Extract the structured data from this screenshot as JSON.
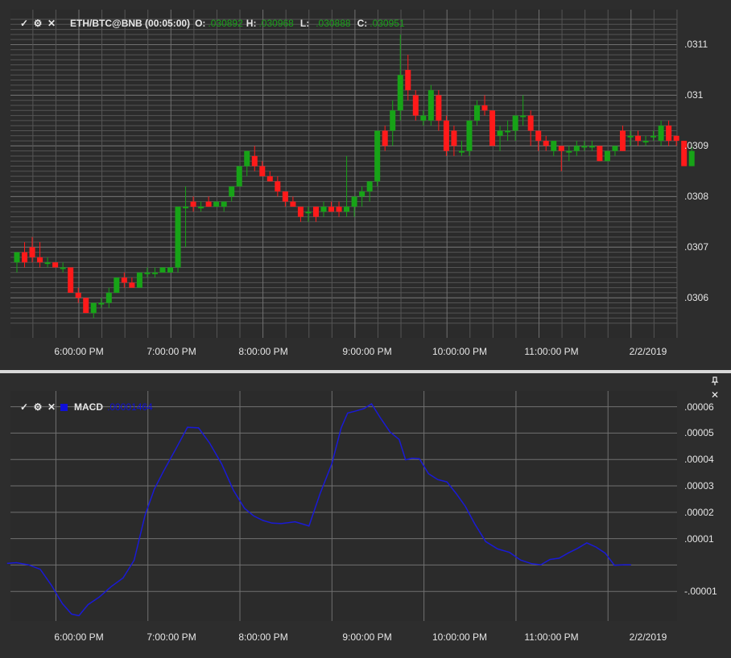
{
  "main_pane": {
    "legend": {
      "symbol": "ETH/BTC@BNB (00:05:00)",
      "open_label": "O:",
      "open_value": ".030892",
      "high_label": "H:",
      "high_value": ".030968",
      "low_label": "L:",
      "low_value": ".030888",
      "close_label": "C:",
      "close_value": ".030951",
      "value_color": "#1aa01a"
    },
    "y_ticks": [
      ".0311",
      ".031",
      ".0309",
      ".0308",
      ".0307",
      ".0306"
    ]
  },
  "macd_pane": {
    "legend": {
      "name": "MACD",
      "value": ".00001464",
      "color": "#1010d8"
    },
    "y_ticks": [
      ".00006",
      ".00005",
      ".00004",
      ".00003",
      ".00002",
      ".00001",
      "-.00001"
    ],
    "pin_icon": "pin-icon",
    "close_icon": "close-icon"
  },
  "time_axis": [
    "6:00:00 PM",
    "7:00:00 PM",
    "8:00:00 PM",
    "9:00:00 PM",
    "10:00:00 PM",
    "11:00:00 PM",
    "2/2/2019"
  ],
  "colors": {
    "up": "#17a317",
    "down": "#ff1a1a",
    "line": "#1a1ad6",
    "grid": "#555555",
    "grid_major": "#707070"
  },
  "chart_data": [
    {
      "type": "candlestick",
      "bar_interval": "00:05:00",
      "ylim": [
        0.03054,
        0.03115
      ],
      "y_ticks": [
        0.0306,
        0.0307,
        0.0308,
        0.0309,
        0.031,
        0.0311
      ],
      "x_start": "5:13 PM",
      "candles": [
        [
          0.03067,
          0.03069,
          0.03065,
          0.03069
        ],
        [
          0.03069,
          0.03071,
          0.03066,
          0.03067
        ],
        [
          0.0307,
          0.03072,
          0.03067,
          0.03068
        ],
        [
          0.03068,
          0.03071,
          0.03066,
          0.03067
        ],
        [
          0.03067,
          0.03068,
          0.03066,
          0.03067
        ],
        [
          0.03067,
          0.03067,
          0.03066,
          0.03066
        ],
        [
          0.03066,
          0.03067,
          0.03065,
          0.03066
        ],
        [
          0.03066,
          0.03066,
          0.03061,
          0.03061
        ],
        [
          0.03061,
          0.03062,
          0.03059,
          0.0306
        ],
        [
          0.0306,
          0.0306,
          0.03057,
          0.03057
        ],
        [
          0.03057,
          0.03059,
          0.03056,
          0.03059
        ],
        [
          0.03059,
          0.0306,
          0.03058,
          0.03059
        ],
        [
          0.03059,
          0.03062,
          0.03058,
          0.03061
        ],
        [
          0.03061,
          0.03064,
          0.03061,
          0.03064
        ],
        [
          0.03064,
          0.03065,
          0.03062,
          0.03063
        ],
        [
          0.03063,
          0.03064,
          0.03062,
          0.03062
        ],
        [
          0.03062,
          0.03065,
          0.03062,
          0.03065
        ],
        [
          0.03065,
          0.03066,
          0.03064,
          0.03065
        ],
        [
          0.03065,
          0.03066,
          0.03064,
          0.03065
        ],
        [
          0.03065,
          0.03066,
          0.03065,
          0.03066
        ],
        [
          0.03065,
          0.03066,
          0.03065,
          0.03066
        ],
        [
          0.03066,
          0.03078,
          0.03065,
          0.03078
        ],
        [
          0.03078,
          0.03082,
          0.0307,
          0.03078
        ],
        [
          0.03079,
          0.0308,
          0.03077,
          0.03078
        ],
        [
          0.03078,
          0.03079,
          0.03077,
          0.03078
        ],
        [
          0.03079,
          0.0308,
          0.03078,
          0.03078
        ],
        [
          0.03078,
          0.03079,
          0.03078,
          0.03079
        ],
        [
          0.03078,
          0.03079,
          0.03077,
          0.03079
        ],
        [
          0.0308,
          0.03082,
          0.03079,
          0.03082
        ],
        [
          0.03082,
          0.03086,
          0.03082,
          0.03086
        ],
        [
          0.03086,
          0.03089,
          0.03084,
          0.03089
        ],
        [
          0.03088,
          0.0309,
          0.03085,
          0.03086
        ],
        [
          0.03086,
          0.03087,
          0.03084,
          0.03084
        ],
        [
          0.03084,
          0.03085,
          0.03083,
          0.03083
        ],
        [
          0.03083,
          0.03084,
          0.0308,
          0.03081
        ],
        [
          0.03081,
          0.03081,
          0.03078,
          0.03079
        ],
        [
          0.03079,
          0.0308,
          0.03078,
          0.03078
        ],
        [
          0.03078,
          0.03078,
          0.03075,
          0.03076
        ],
        [
          0.03077,
          0.03078,
          0.03075,
          0.03077
        ],
        [
          0.03078,
          0.03078,
          0.03075,
          0.03076
        ],
        [
          0.03077,
          0.03079,
          0.03076,
          0.03078
        ],
        [
          0.03078,
          0.03079,
          0.03077,
          0.03077
        ],
        [
          0.03078,
          0.03079,
          0.03076,
          0.03077
        ],
        [
          0.03077,
          0.03088,
          0.03076,
          0.03078
        ],
        [
          0.03078,
          0.0308,
          0.03076,
          0.0308
        ],
        [
          0.0308,
          0.03082,
          0.03078,
          0.03081
        ],
        [
          0.03081,
          0.03083,
          0.03079,
          0.03083
        ],
        [
          0.03083,
          0.03093,
          0.03082,
          0.03093
        ],
        [
          0.03093,
          0.03094,
          0.03089,
          0.0309
        ],
        [
          0.03093,
          0.03099,
          0.0309,
          0.03097
        ],
        [
          0.03097,
          0.03112,
          0.03095,
          0.03104
        ],
        [
          0.03105,
          0.03108,
          0.03099,
          0.03101
        ],
        [
          0.031,
          0.03101,
          0.03095,
          0.03096
        ],
        [
          0.03095,
          0.03097,
          0.03094,
          0.03096
        ],
        [
          0.03095,
          0.03102,
          0.03094,
          0.03101
        ],
        [
          0.031,
          0.03101,
          0.03093,
          0.03095
        ],
        [
          0.03095,
          0.03096,
          0.03088,
          0.03089
        ],
        [
          0.03093,
          0.03094,
          0.03088,
          0.0309
        ],
        [
          0.03089,
          0.03091,
          0.03088,
          0.03089
        ],
        [
          0.03089,
          0.03095,
          0.03088,
          0.03095
        ],
        [
          0.03095,
          0.03099,
          0.03094,
          0.03098
        ],
        [
          0.03098,
          0.031,
          0.03096,
          0.03097
        ],
        [
          0.03097,
          0.03097,
          0.0309,
          0.0309
        ],
        [
          0.03092,
          0.03094,
          0.03089,
          0.03093
        ],
        [
          0.03093,
          0.03095,
          0.03091,
          0.03093
        ],
        [
          0.03093,
          0.03095,
          0.03091,
          0.03096
        ],
        [
          0.03096,
          0.031,
          0.03094,
          0.03096
        ],
        [
          0.03096,
          0.03097,
          0.0309,
          0.03093
        ],
        [
          0.03093,
          0.03093,
          0.03089,
          0.03091
        ],
        [
          0.03091,
          0.03092,
          0.03089,
          0.0309
        ],
        [
          0.03089,
          0.03091,
          0.03088,
          0.03091
        ],
        [
          0.0309,
          0.0309,
          0.03085,
          0.03089
        ],
        [
          0.03089,
          0.0309,
          0.03087,
          0.03089
        ],
        [
          0.03089,
          0.03091,
          0.03088,
          0.0309
        ],
        [
          0.0309,
          0.03091,
          0.03089,
          0.0309
        ],
        [
          0.0309,
          0.03091,
          0.03089,
          0.0309
        ],
        [
          0.0309,
          0.0309,
          0.03087,
          0.03087
        ],
        [
          0.03087,
          0.03089,
          0.03087,
          0.03089
        ],
        [
          0.03089,
          0.0309,
          0.03088,
          0.0309
        ],
        [
          0.03093,
          0.03094,
          0.03089,
          0.03089
        ],
        [
          0.03092,
          0.03093,
          0.0309,
          0.03092
        ],
        [
          0.03092,
          0.03093,
          0.0309,
          0.03091
        ],
        [
          0.03091,
          0.03092,
          0.0309,
          0.03091
        ],
        [
          0.03092,
          0.03093,
          0.03091,
          0.03092
        ],
        [
          0.03091,
          0.03095,
          0.0309,
          0.03094
        ],
        [
          0.03094,
          0.03095,
          0.0309,
          0.03091
        ],
        [
          0.03092,
          0.03092,
          0.0309,
          0.03091
        ],
        [
          0.03091,
          0.03091,
          0.03086,
          0.03086
        ],
        [
          0.03086,
          0.0309,
          0.03086,
          0.03089
        ]
      ]
    },
    {
      "type": "line",
      "series": [
        {
          "name": "MACD",
          "color": "#1a1ad6"
        }
      ],
      "ylim": [
        -2e-05,
        6.05e-05
      ],
      "y_ticks": [
        -1e-05,
        1e-05,
        2e-05,
        3e-05,
        4e-05,
        5e-05,
        6e-05
      ],
      "x_hours_from_6pm": [
        -0.78,
        -0.68,
        -0.55,
        -0.42,
        -0.3,
        -0.18,
        -0.08,
        0.0,
        0.1,
        0.22,
        0.35,
        0.48,
        0.6,
        0.72,
        0.82,
        0.92,
        1.05,
        1.18,
        1.3,
        1.42,
        1.55,
        1.68,
        1.8,
        1.9,
        2.0,
        2.1,
        2.2,
        2.35,
        2.5,
        2.62,
        2.75,
        2.85,
        2.92,
        3.0,
        3.1,
        3.18,
        3.28,
        3.38,
        3.48,
        3.55,
        3.62,
        3.7,
        3.8,
        3.9,
        4.0,
        4.1,
        4.2,
        4.3,
        4.42,
        4.55,
        4.68,
        4.8,
        4.92,
        5.02,
        5.12,
        5.22,
        5.32,
        5.42,
        5.52,
        5.62,
        5.72,
        5.82,
        5.92,
        6.0
      ],
      "values": [
        6e-07,
        9e-07,
        1e-07,
        -1.6e-06,
        -7.6e-06,
        -1.46e-05,
        -1.86e-05,
        -1.92e-05,
        -1.5e-05,
        -1.22e-05,
        -8.2e-06,
        -4.9e-06,
        1.8e-06,
        1.9e-05,
        2.88e-05,
        3.56e-05,
        4.38e-05,
        5.22e-05,
        5.2e-05,
        4.63e-05,
        3.84e-05,
        2.83e-05,
        2.15e-05,
        1.86e-05,
        1.69e-05,
        1.59e-05,
        1.57e-05,
        1.64e-05,
        1.48e-05,
        2.7e-05,
        3.85e-05,
        5.2e-05,
        5.76e-05,
        5.83e-05,
        5.93e-05,
        6.11e-05,
        5.56e-05,
        5.05e-05,
        4.76e-05,
        3.99e-05,
        4.05e-05,
        4.03e-05,
        3.46e-05,
        3.24e-05,
        3.15e-05,
        2.71e-05,
        2.22e-05,
        1.57e-05,
        8.9e-06,
        6.1e-06,
        4.8e-06,
        1.9e-06,
        5e-07,
        1e-07,
        2.1e-06,
        2.6e-06,
        4.6e-06,
        6.3e-06,
        8.4e-06,
        6.8e-06,
        4.5e-06,
        -1e-07,
        1e-07,
        1e-07
      ]
    }
  ]
}
